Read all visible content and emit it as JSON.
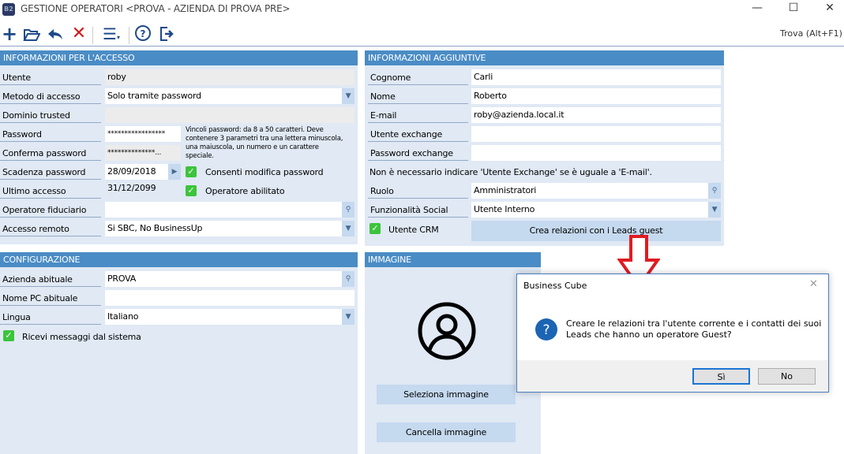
{
  "window": {
    "title": "GESTIONE OPERATORI <PROVA - AZIENDA DI PROVA PRE>",
    "logo": "B2"
  },
  "toolbar": {
    "icons": [
      "plus-icon",
      "folder-open-icon",
      "undo-icon",
      "delete-icon",
      "menu-icon",
      "help-icon",
      "exit-icon"
    ],
    "search_label": "Trova (Alt+F1)"
  },
  "access": {
    "header": "INFORMAZIONI PER L'ACCESSO",
    "utente_label": "Utente",
    "utente": "roby",
    "metodo_label": "Metodo di accesso",
    "metodo": "Solo tramite password",
    "dominio_label": "Dominio trusted",
    "password_label": "Password",
    "password": "*****************",
    "conferma_label": "Conferma password",
    "conferma": "**************...",
    "vincoli": "Vincoli password: da 8 a 50 caratteri. Deve contenere 3 parametri tra una lettera minuscola, una maiuscola, un numero e un carattere speciale.",
    "scadenza_label": "Scadenza password",
    "scadenza": "28/09/2018",
    "consenti_label": "Consenti modifica password",
    "ultimo_label": "Ultimo accesso",
    "ultimo": "31/12/2099",
    "abilitato_label": "Operatore abilitato",
    "fiduciario_label": "Operatore fiduciario",
    "remoto_label": "Accesso remoto",
    "remoto": "Si SBC, No BusinessUp"
  },
  "extra": {
    "header": "INFORMAZIONI AGGIUNTIVE",
    "cognome_label": "Cognome",
    "cognome": "Carli",
    "nome_label": "Nome",
    "nome": "Roberto",
    "email_label": "E-mail",
    "email": "roby@azienda.local.it",
    "exuser_label": "Utente exchange",
    "expass_label": "Password exchange",
    "note": "Non è necessario indicare 'Utente Exchange' se è uguale a 'E-mail'.",
    "ruolo_label": "Ruolo",
    "ruolo": "Amministratori",
    "social_label": "Funzionalità Social",
    "social": "Utente Interno",
    "crm_label": "Utente CRM",
    "leads_button": "Crea relazioni con i Leads guest"
  },
  "config": {
    "header": "CONFIGURAZIONE",
    "azienda_label": "Azienda abituale",
    "azienda": "PROVA",
    "pc_label": "Nome PC abituale",
    "lingua_label": "Lingua",
    "lingua": "Italiano",
    "messaggi_label": "Ricevi messaggi dal sistema"
  },
  "image": {
    "header": "IMMAGINE",
    "select_button": "Seleziona immagine",
    "delete_button": "Cancella immagine"
  },
  "dialog": {
    "title": "Business Cube",
    "message_line1": "Creare le relazioni tra l'utente corrente e i contatti dei suoi",
    "message_line2": "Leads che hanno un operatore Guest?",
    "yes": "Sì",
    "no": "No"
  },
  "colors": {
    "header": "#4a8cc5",
    "panel": "#e0e9f4",
    "arrow": "#e01b22",
    "check": "#3cc43c"
  }
}
